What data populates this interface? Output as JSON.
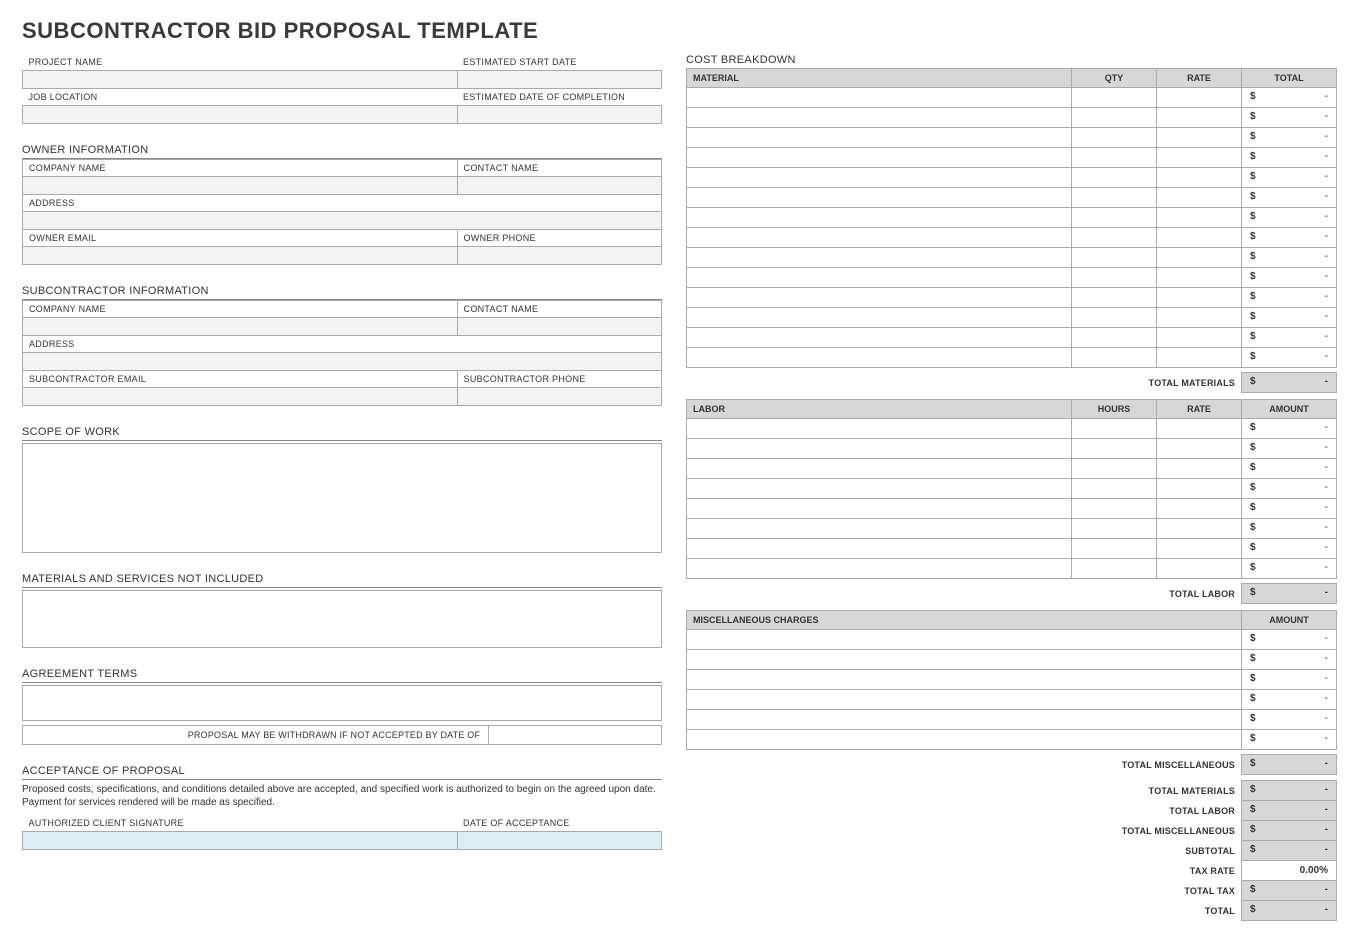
{
  "title": "SUBCONTRACTOR BID PROPOSAL TEMPLATE",
  "left": {
    "project_name": "PROJECT NAME",
    "est_start": "ESTIMATED START DATE",
    "job_location": "JOB LOCATION",
    "est_complete": "ESTIMATED DATE OF COMPLETION",
    "owner_info": "OWNER INFORMATION",
    "owner_company": "COMPANY NAME",
    "owner_contact": "CONTACT NAME",
    "owner_address": "ADDRESS",
    "owner_email": "OWNER EMAIL",
    "owner_phone": "OWNER PHONE",
    "sub_info": "SUBCONTRACTOR INFORMATION",
    "sub_company": "COMPANY NAME",
    "sub_contact": "CONTACT NAME",
    "sub_address": "ADDRESS",
    "sub_email": "SUBCONTRACTOR EMAIL",
    "sub_phone": "SUBCONTRACTOR PHONE",
    "scope": "SCOPE OF WORK",
    "not_included": "MATERIALS AND SERVICES NOT INCLUDED",
    "agreement": "AGREEMENT TERMS",
    "withdraw": "PROPOSAL MAY BE WITHDRAWN IF NOT ACCEPTED BY DATE OF",
    "acceptance": "ACCEPTANCE OF PROPOSAL",
    "accept_fine": "Proposed costs, specifications, and conditions detailed above are accepted, and specified work is authorized to begin on the agreed upon date.  Payment for services rendered will be made as specified.",
    "sig": "AUTHORIZED CLIENT SIGNATURE",
    "sig_date": "DATE OF ACCEPTANCE"
  },
  "right": {
    "cost_breakdown": "COST BREAKDOWN",
    "material": "MATERIAL",
    "qty": "QTY",
    "rate": "RATE",
    "total": "TOTAL",
    "labor": "LABOR",
    "hours": "HOURS",
    "amount": "AMOUNT",
    "misc": "MISCELLANEOUS CHARGES",
    "total_materials": "TOTAL MATERIALS",
    "total_labor": "TOTAL LABOR",
    "total_misc": "TOTAL MISCELLANEOUS",
    "subtotal": "SUBTOTAL",
    "tax_rate": "TAX RATE",
    "tax_rate_val": "0.00%",
    "total_tax": "TOTAL TAX",
    "grand_total": "TOTAL",
    "currency": "$",
    "dash": "-",
    "material_rows": 14,
    "labor_rows": 8,
    "misc_rows": 6
  }
}
